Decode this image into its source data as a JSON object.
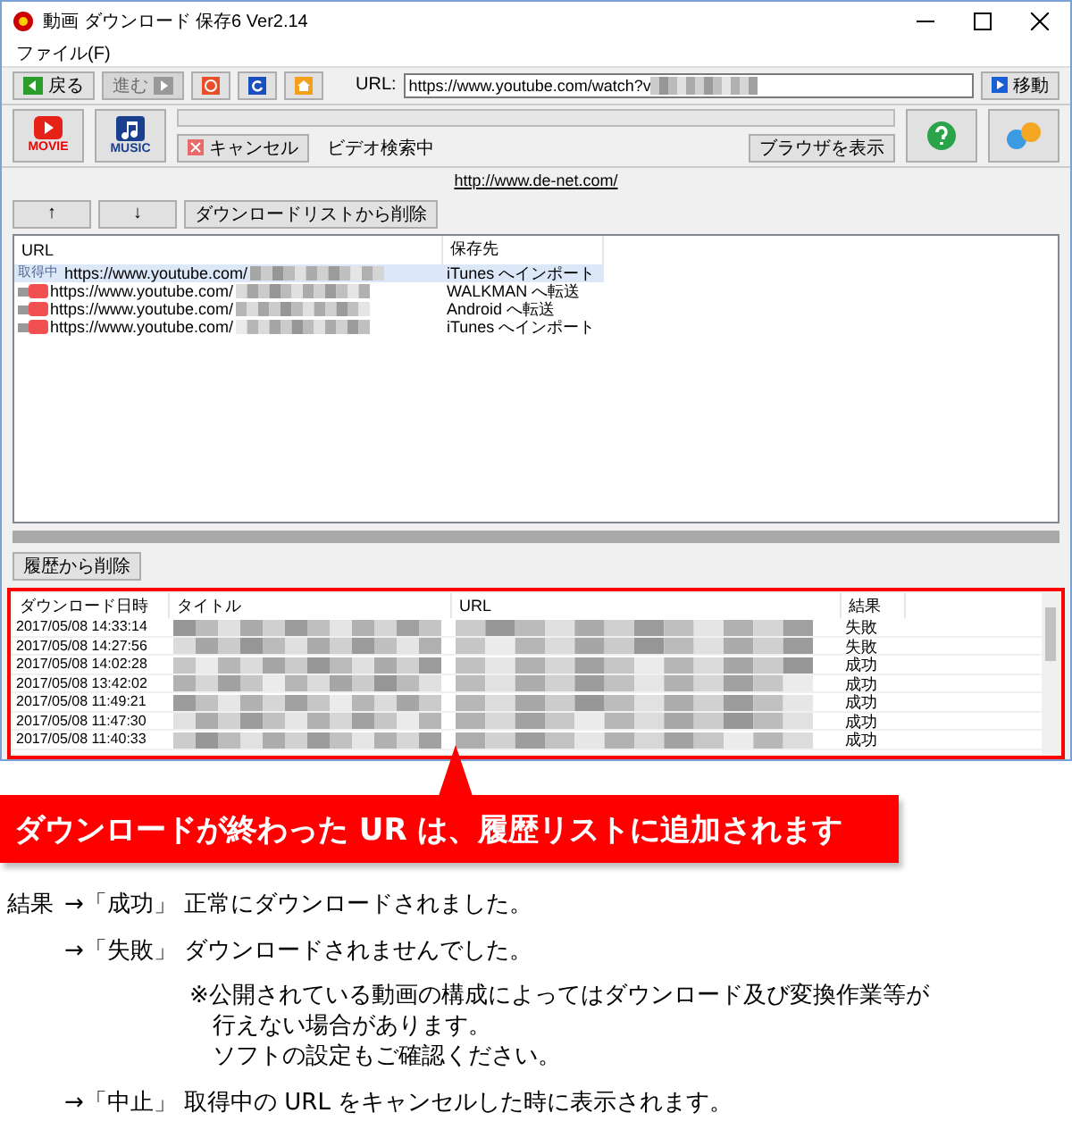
{
  "window": {
    "title": "動画 ダウンロード 保存6 Ver2.14"
  },
  "menu": [
    "ファイル(F)"
  ],
  "toolbar": {
    "back": {
      "label": "戻る",
      "disabled": false
    },
    "forward": {
      "label": "進む",
      "disabled": true
    },
    "url_label": "URL:",
    "url_value": "https://www.youtube.com/watch?v",
    "go": "移動"
  },
  "modes": [
    {
      "kind": "movie",
      "label": "MOVIE"
    },
    {
      "kind": "music",
      "label": "MUSIC"
    }
  ],
  "progress": {
    "level": 0
  },
  "cancel": "キャンセル",
  "status": "ビデオ検索中",
  "show_browser": "ブラウザを表示",
  "link": "http://www.de-net.com/",
  "list_buttons": [
    "↑",
    "↓",
    "ダウンロードリストから削除"
  ],
  "download_list": {
    "columns": [
      "URL",
      "保存先"
    ],
    "rows": [
      {
        "kind": "fetching",
        "badge": "取得中",
        "url": "https://www.youtube.com/",
        "destination": "iTunes へインポート",
        "selected": true
      },
      {
        "kind": "video",
        "url": "https://www.youtube.com/",
        "destination": "WALKMAN へ転送",
        "selected": false
      },
      {
        "kind": "video",
        "url": "https://www.youtube.com/",
        "destination": "Android へ転送",
        "selected": false
      },
      {
        "kind": "video",
        "url": "https://www.youtube.com/",
        "destination": "iTunes へインポート",
        "selected": false
      }
    ]
  },
  "history_button": "履歴から削除",
  "history": {
    "columns": [
      "ダウンロード日時",
      "タイトル",
      "URL",
      "結果"
    ],
    "rows": [
      {
        "date": "2017/05/08 14:33:14",
        "result": "失敗"
      },
      {
        "date": "2017/05/08 14:27:56",
        "result": "失敗"
      },
      {
        "date": "2017/05/08 14:02:28",
        "result": "成功"
      },
      {
        "date": "2017/05/08 13:42:02",
        "result": "成功"
      },
      {
        "date": "2017/05/08 11:49:21",
        "result": "成功"
      },
      {
        "date": "2017/05/08 11:47:30",
        "result": "成功"
      },
      {
        "date": "2017/05/08 11:40:33",
        "result": "成功"
      }
    ]
  },
  "callout": "ダウンロードが終わった UR は、履歴リストに追加されます",
  "notes": [
    {
      "kind": "line",
      "label": "結果",
      "text": "→「成功」 正常にダウンロードされました。"
    },
    {
      "kind": "line",
      "text": "→「失敗」 ダウンロードされませんでした。"
    },
    {
      "kind": "remark",
      "lines": [
        "※公開されている動画の構成によってはダウンロード及び変換作業等が",
        "行えない場合があります。",
        "ソフトの設定もご確認ください。"
      ]
    },
    {
      "kind": "line",
      "text": "→「中止」 取得中の URL をキャンセルした時に表示されます。"
    }
  ]
}
